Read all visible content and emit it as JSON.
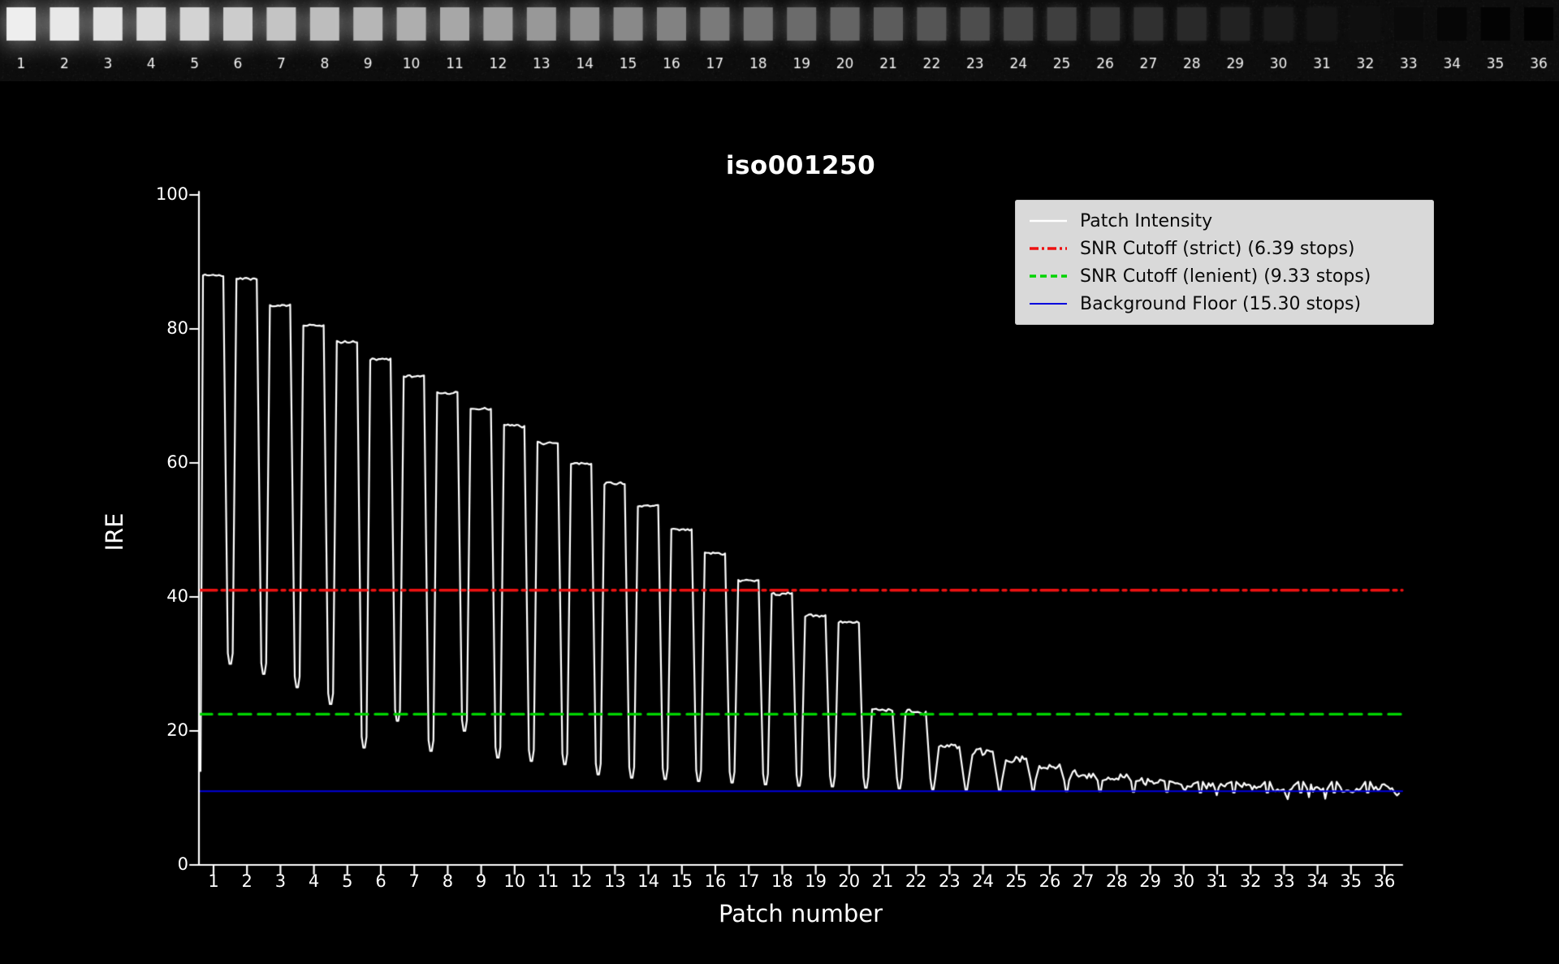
{
  "film_strip": {
    "patch_numbers": [
      "1",
      "2",
      "3",
      "4",
      "5",
      "6",
      "7",
      "8",
      "9",
      "10",
      "11",
      "12",
      "13",
      "14",
      "15",
      "16",
      "17",
      "18",
      "19",
      "20",
      "21",
      "22",
      "23",
      "24",
      "25",
      "26",
      "27",
      "28",
      "29",
      "30",
      "31",
      "32",
      "33",
      "34",
      "35",
      "36"
    ],
    "patch_gray_values": [
      238,
      232,
      225,
      218,
      211,
      204,
      196,
      189,
      182,
      174,
      167,
      160,
      152,
      145,
      137,
      130,
      122,
      115,
      107,
      100,
      92,
      85,
      77,
      70,
      63,
      55,
      48,
      41,
      34,
      27,
      21,
      15,
      10,
      6,
      3,
      2
    ],
    "label_color": "#f2f2f2",
    "background_gray": "#0d0d0d"
  },
  "chart_data": {
    "type": "line",
    "title": "iso001250",
    "xlabel": "Patch number",
    "ylabel": "IRE",
    "background": "#000000",
    "axis_color": "#ffffff",
    "ylim": [
      0,
      100
    ],
    "xlim": [
      0.5,
      36.6
    ],
    "yticks": [
      "0",
      "20",
      "40",
      "60",
      "80",
      "100"
    ],
    "ytick_values": [
      0,
      20,
      40,
      60,
      80,
      100
    ],
    "xticks": [
      "1",
      "2",
      "3",
      "4",
      "5",
      "6",
      "7",
      "8",
      "9",
      "10",
      "11",
      "12",
      "13",
      "14",
      "15",
      "16",
      "17",
      "18",
      "19",
      "20",
      "21",
      "22",
      "23",
      "24",
      "25",
      "26",
      "27",
      "28",
      "29",
      "30",
      "31",
      "32",
      "33",
      "34",
      "35",
      "36"
    ],
    "xtick_values": [
      1,
      2,
      3,
      4,
      5,
      6,
      7,
      8,
      9,
      10,
      11,
      12,
      13,
      14,
      15,
      16,
      17,
      18,
      19,
      20,
      21,
      22,
      23,
      24,
      25,
      26,
      27,
      28,
      29,
      30,
      31,
      32,
      33,
      34,
      35,
      36
    ],
    "grid": false,
    "legend_position": "upper right",
    "series": [
      {
        "name": "Patch Intensity",
        "kind": "waveform",
        "color": "#ffffff",
        "style": "solid",
        "start_value": 14,
        "plateaus": [
          88,
          87.6,
          83.5,
          80.5,
          78,
          75.5,
          73,
          70.5,
          68,
          65.5,
          63,
          60,
          57,
          53.5,
          50,
          46.5,
          42.5,
          40.5,
          37.2,
          36.2,
          23.2,
          22.8,
          17.8,
          16.5,
          15.7,
          14.4,
          13.5,
          12.9,
          12.4,
          12,
          11.8,
          11.6,
          11.4,
          11.3,
          11.2,
          11.1
        ],
        "dips": [
          30,
          28.5,
          26.5,
          24,
          17.5,
          21.5,
          17,
          20,
          16,
          15.5,
          15,
          13.5,
          13,
          12.8,
          12.5,
          12.3,
          12,
          11.8,
          11.7,
          11.5,
          11.4,
          11.3,
          11.2,
          11.1,
          11.1,
          11,
          11,
          10.9,
          10.9,
          10.8,
          10.8,
          10.8,
          10.8,
          10.8,
          10.8
        ]
      },
      {
        "name": "SNR Cutoff (strict) (6.39 stops)",
        "kind": "hline",
        "y": 41.0,
        "color": "#ee1111",
        "style": "dashdot"
      },
      {
        "name": "SNR Cutoff (lenient) (9.33 stops)",
        "kind": "hline",
        "y": 22.5,
        "color": "#00d400",
        "style": "dashed"
      },
      {
        "name": "Background Floor (15.30 stops)",
        "kind": "hline",
        "y": 11.0,
        "color": "#0000dd",
        "style": "solid"
      }
    ],
    "legend_background": "#d9d9d9"
  }
}
